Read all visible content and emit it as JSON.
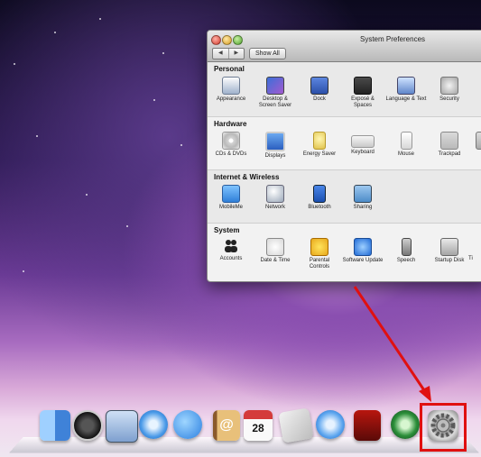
{
  "window": {
    "title": "System Preferences",
    "show_all_label": "Show All",
    "nav_back": "◀",
    "nav_forward": "▶"
  },
  "sections": [
    {
      "title": "Personal",
      "items": [
        {
          "label": "Appearance",
          "icon": "appearance-icon"
        },
        {
          "label": "Desktop & Screen Saver",
          "icon": "desktop-screensaver-icon"
        },
        {
          "label": "Dock",
          "icon": "dock-icon"
        },
        {
          "label": "Exposé & Spaces",
          "icon": "expose-spaces-icon"
        },
        {
          "label": "Language & Text",
          "icon": "language-text-icon"
        },
        {
          "label": "Security",
          "icon": "security-icon"
        }
      ]
    },
    {
      "title": "Hardware",
      "items": [
        {
          "label": "CDs & DVDs",
          "icon": "cds-dvds-icon"
        },
        {
          "label": "Displays",
          "icon": "displays-icon"
        },
        {
          "label": "Energy Saver",
          "icon": "energy-saver-icon"
        },
        {
          "label": "Keyboard",
          "icon": "keyboard-icon"
        },
        {
          "label": "Mouse",
          "icon": "mouse-icon"
        },
        {
          "label": "Trackpad",
          "icon": "trackpad-icon"
        }
      ]
    },
    {
      "title": "Internet & Wireless",
      "items": [
        {
          "label": "MobileMe",
          "icon": "mobileme-icon"
        },
        {
          "label": "Network",
          "icon": "network-icon"
        },
        {
          "label": "Bluetooth",
          "icon": "bluetooth-icon"
        },
        {
          "label": "Sharing",
          "icon": "sharing-icon"
        }
      ]
    },
    {
      "title": "System",
      "items": [
        {
          "label": "Accounts",
          "icon": "accounts-icon"
        },
        {
          "label": "Date & Time",
          "icon": "date-time-icon"
        },
        {
          "label": "Parental Controls",
          "icon": "parental-controls-icon"
        },
        {
          "label": "Software Update",
          "icon": "software-update-icon"
        },
        {
          "label": "Speech",
          "icon": "speech-icon"
        },
        {
          "label": "Startup Disk",
          "icon": "startup-disk-icon"
        },
        {
          "label": "Ti",
          "icon": "time-machine-icon"
        }
      ]
    }
  ],
  "dock": {
    "items": [
      {
        "name": "Finder",
        "icon": "finder-icon"
      },
      {
        "name": "Dashboard",
        "icon": "dashboard-icon"
      },
      {
        "name": "Mail",
        "icon": "mail-icon"
      },
      {
        "name": "Safari",
        "icon": "safari-icon"
      },
      {
        "name": "iChat",
        "icon": "ichat-icon"
      },
      {
        "name": "Address Book",
        "icon": "address-book-icon",
        "glyph": "@"
      },
      {
        "name": "iCal",
        "icon": "ical-icon",
        "glyph": "28"
      },
      {
        "name": "Preview",
        "icon": "preview-icon"
      },
      {
        "name": "iTunes",
        "icon": "itunes-icon"
      },
      {
        "name": "Photo Booth",
        "icon": "photo-booth-icon"
      },
      {
        "name": "Time Machine",
        "icon": "time-machine-icon"
      },
      {
        "name": "System Preferences",
        "icon": "system-preferences-icon"
      }
    ]
  },
  "annotation": {
    "highlight_color": "#e01010",
    "target": "System Preferences"
  }
}
